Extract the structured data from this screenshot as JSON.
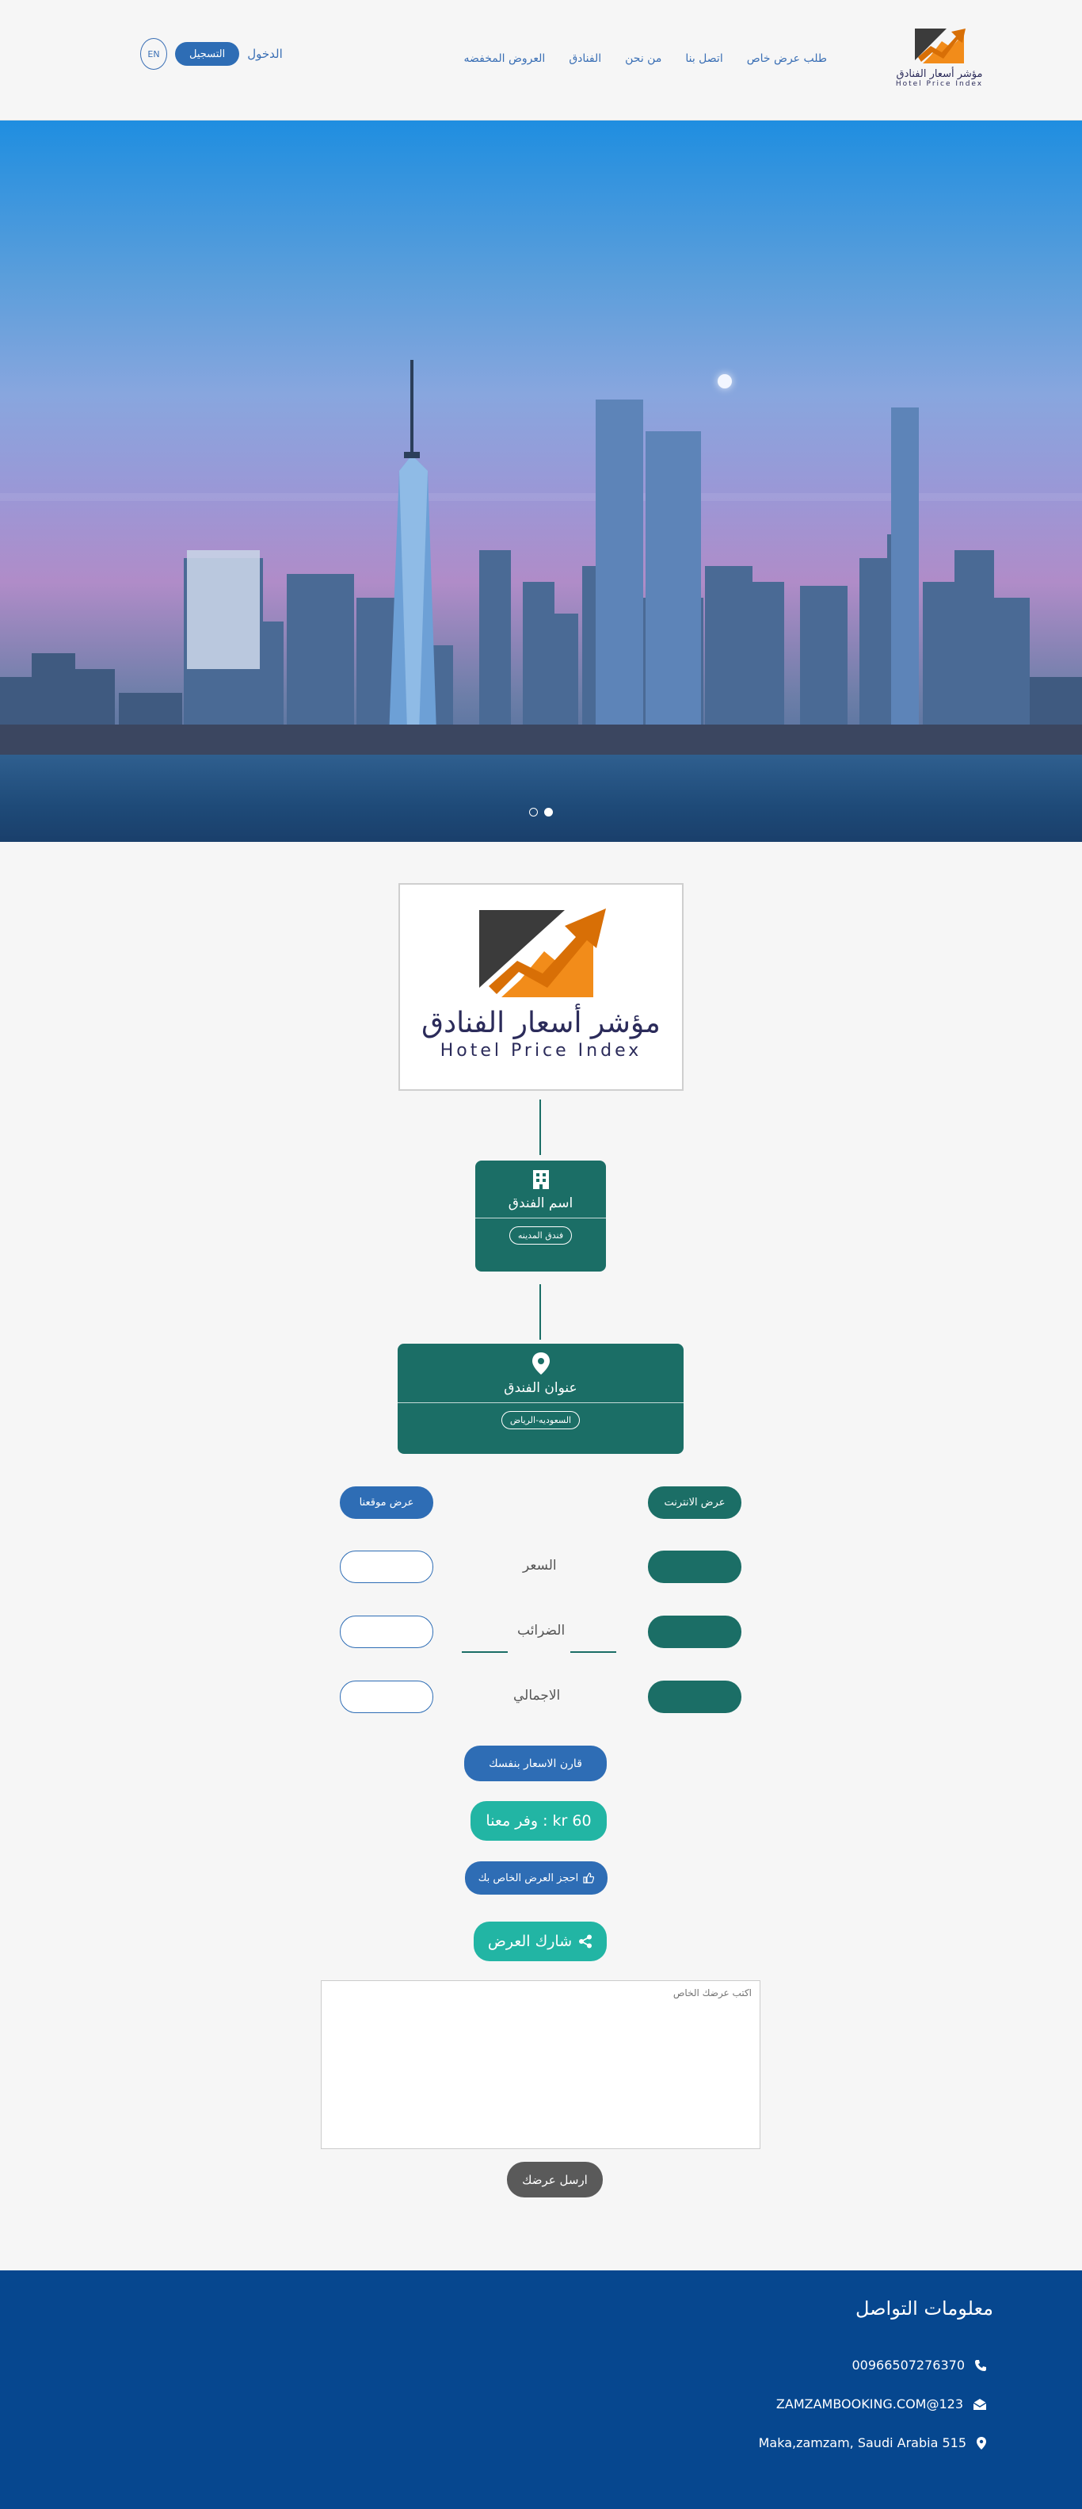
{
  "navbar": {
    "logo": {
      "arabic": "مؤشر أسعار الفنادق",
      "english": "Hotel Price Index"
    },
    "menu": [
      "العروض المخفضه",
      "الفنادق",
      "من نحن",
      "اتصل بنا",
      "طلب عرض خاص"
    ],
    "lang": "EN",
    "register": "التسجيل",
    "login": "الدخول"
  },
  "hero": {
    "slides": 2,
    "active_slide": 2
  },
  "main": {
    "logo": {
      "arabic": "مؤشر أسعار الفنادق",
      "english": "Hotel Price Index"
    },
    "hotel_name_title": "اسم الفندق",
    "hotel_name_value": "فندق المدينه",
    "hotel_address_title": "عنوان الفندق",
    "hotel_address_value": "السعوديه-الرياض",
    "internet_offer": "عرض الانترنت",
    "our_offer": "عرض موقعنا",
    "price_label": "السعر",
    "taxes_label": "الضرائب",
    "total_label": "الاجمالي",
    "compare_button": "قارن الاسعار بنفسك",
    "save_button": "وفر معنا : kr 60",
    "book_button": "احجز العرض الخاص بك",
    "share_button": "شارك العرض",
    "offer_placeholder": "اكتب عرضك الخاص",
    "send_button": "ارسل عرضك"
  },
  "footer": {
    "title": "معلومات التواصل",
    "phone": "00966507276370",
    "email": "ZAMZAMBOOKING.COM@123",
    "address": "Maka,zamzam, Saudi Arabia 515"
  },
  "colors": {
    "green": "#1b6e66",
    "blue": "#2e6db5",
    "teal": "#22b5a4",
    "footer": "#06478f",
    "orange": "#f28c1a"
  }
}
